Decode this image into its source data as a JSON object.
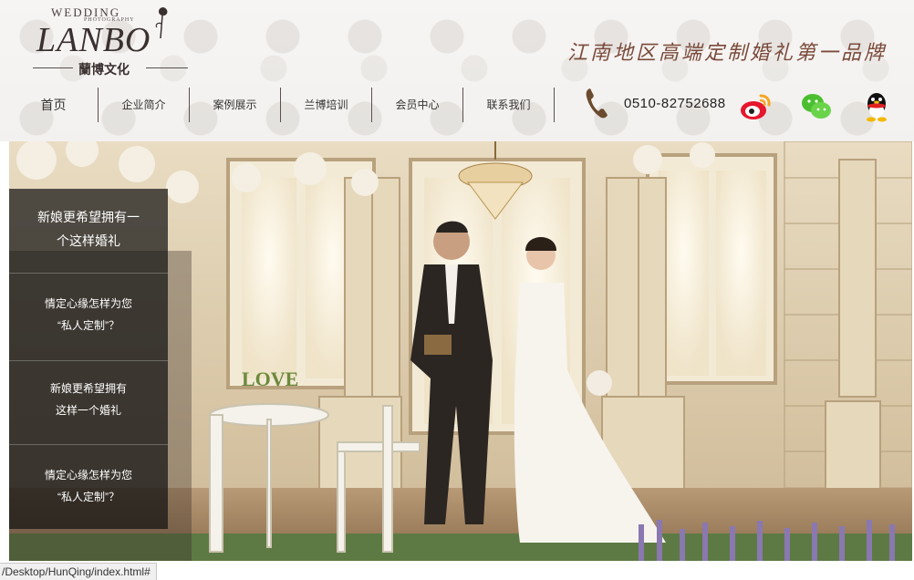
{
  "logo": {
    "top_text": "WEDDING",
    "photo_text": "PHOTOGRAPHY",
    "main_text": "LANBO",
    "sub_text": "蘭博文化"
  },
  "slogan": "江南地区高端定制婚礼第一品牌",
  "nav": {
    "items": [
      {
        "label": "首页"
      },
      {
        "label": "企业简介"
      },
      {
        "label": "案例展示"
      },
      {
        "label": "兰博培训"
      },
      {
        "label": "会员中心"
      },
      {
        "label": "联系我们"
      }
    ]
  },
  "contact": {
    "phone_icon": "phone-icon",
    "phone": "0510-82752688",
    "social": [
      "weibo-icon",
      "wechat-icon",
      "qq-icon"
    ]
  },
  "banner": {
    "sign_text": "LOVE"
  },
  "side_menu": {
    "items": [
      {
        "line1": "新娘更希望拥有一",
        "line2": "个这样婚礼"
      },
      {
        "line1": "情定心缘怎样为您",
        "line2": "“私人定制”？"
      },
      {
        "line1": "新娘更希望拥有",
        "line2": "这样一个婚礼"
      },
      {
        "line1": "情定心缘怎样为您",
        "line2": "“私人定制”？"
      }
    ]
  },
  "status_bar": {
    "url": "/Desktop/HunQing/index.html#"
  },
  "colors": {
    "nav_divider": "#5a5050",
    "slogan": "#7a4a3a",
    "side_menu_bg": "rgba(20,20,20,0.72)"
  }
}
